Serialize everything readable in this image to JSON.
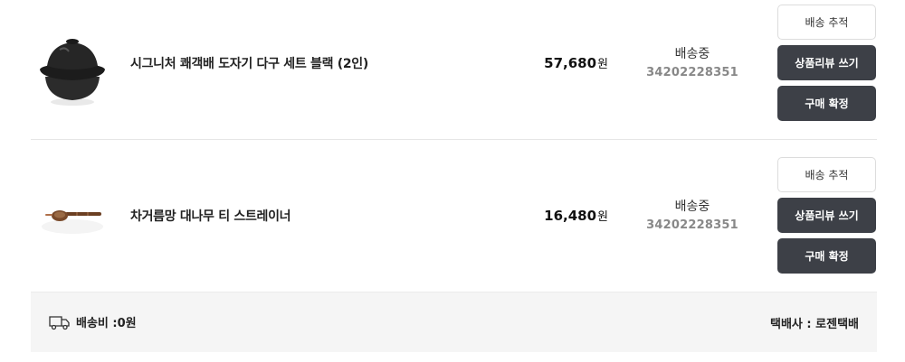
{
  "orders": [
    {
      "product_name": "시그니처 쾌객배 도자기 다구 세트 블랙 (2인)",
      "price_amount": "57,680",
      "price_unit": "원",
      "status": "배송중",
      "tracking_number": "34202228351",
      "buttons": {
        "track": "배송 추적",
        "review": "상품리뷰 쓰기",
        "confirm": "구매 확정"
      },
      "thumbnail_icon": "black-ceramic-teaset-image"
    },
    {
      "product_name": "차거름망 대나무 티 스트레이너",
      "price_amount": "16,480",
      "price_unit": "원",
      "status": "배송중",
      "tracking_number": "34202228351",
      "buttons": {
        "track": "배송 추적",
        "review": "상품리뷰 쓰기",
        "confirm": "구매 확정"
      },
      "thumbnail_icon": "bamboo-tea-strainer-image"
    }
  ],
  "footer": {
    "shipping_fee": "배송비 :0원",
    "courier": "택배사 : 로젠택배",
    "truck_icon": "truck-icon"
  },
  "colors": {
    "dark_button": "#3d4047",
    "footer_bg": "#f5f5f5"
  }
}
